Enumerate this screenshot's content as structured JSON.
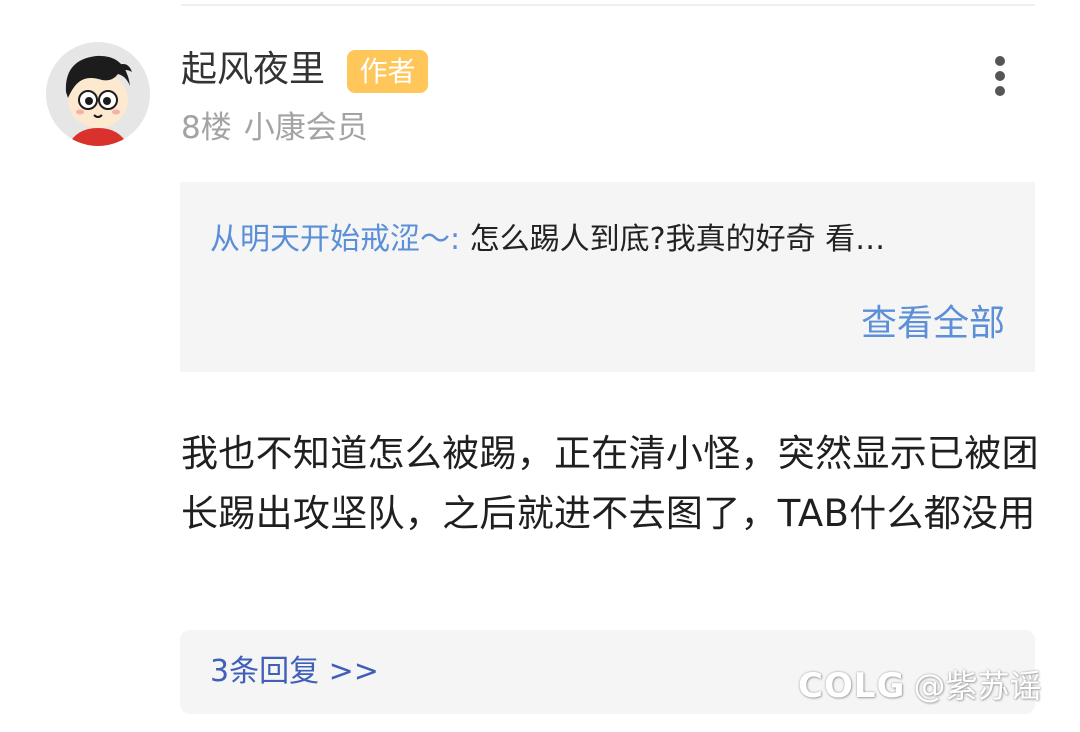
{
  "post": {
    "username": "起风夜里",
    "badge": "作者",
    "floor": "8楼",
    "member_level": "小康会员",
    "quote": {
      "author": "从明天开始戒涩～:",
      "text": "怎么踢人到底?我真的好奇 看…",
      "view_all_label": "查看全部"
    },
    "body": "我也不知道怎么被踢，正在清小怪，突然显示已被团长踢出攻坚队，之后就进不去图了，TAB什么都没用",
    "replies_label": "3条回复 >>"
  },
  "icons": {
    "more": "more-vertical-icon",
    "avatar": "cartoon-avatar"
  },
  "watermark": {
    "logo": "COLG",
    "handle": "@紫苏谣"
  },
  "colors": {
    "badge": "#ffc65a",
    "link": "#5b8fd8",
    "replies": "#3f5fb8",
    "box_background": "#f5f5f5",
    "meta_text": "#a3a3a3"
  }
}
